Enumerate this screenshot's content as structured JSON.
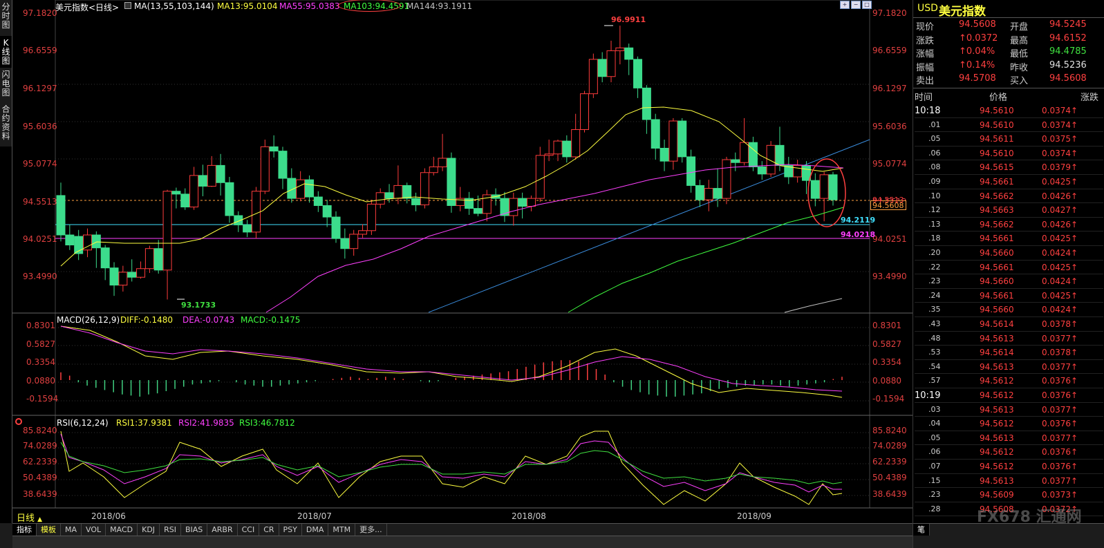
{
  "left_tabs": [
    {
      "label": "分时图"
    },
    {
      "label": "K线图"
    },
    {
      "label": "闪电图"
    },
    {
      "label": "合约资料"
    }
  ],
  "header": {
    "title": "美元指数<日线>",
    "ma_params": "MA(13,55,103,144)",
    "ma13": "MA13:95.0104",
    "ma55": "MA55:95.0383",
    "ma103": "MA103:94.4591",
    "ma144": "MA144:93.1911"
  },
  "price_axis": [
    "97.1820",
    "96.6559",
    "96.1297",
    "95.6036",
    "95.0774",
    "94.5513",
    "94.0251",
    "93.4990"
  ],
  "annotations": {
    "high_label": "96.9911",
    "low_label": "93.1733",
    "current_price_box": "94.5608",
    "cyan_label": "94.2119",
    "magenta_label": "94.0218",
    "small_label": "94.5513"
  },
  "macd": {
    "title": "MACD(26,12,9)",
    "diff": "DIFF:-0.1480",
    "dea": "DEA:-0.0743",
    "macd": "MACD:-0.1475",
    "axis": [
      "0.8301",
      "0.5827",
      "0.3354",
      "0.0880",
      "-0.1594"
    ]
  },
  "rsi": {
    "title": "RSI(6,12,24)",
    "rsi1": "RSI1:37.9381",
    "rsi2": "RSI2:41.9835",
    "rsi3": "RSI3:46.7812",
    "axis": [
      "85.8240",
      "74.0289",
      "62.2339",
      "50.4389",
      "38.6439"
    ]
  },
  "dates": [
    "2018/06",
    "2018/07",
    "2018/08",
    "2018/09"
  ],
  "period_button": "日线",
  "bottom_tabs": [
    "指标",
    "模板",
    "MA",
    "VOL",
    "MACD",
    "KDJ",
    "RSI",
    "BIAS",
    "ARBR",
    "CCI",
    "CR",
    "PSY",
    "DMA",
    "MTM",
    "更多..."
  ],
  "quote": {
    "symbol": "USD",
    "name": "美元指数",
    "rows": [
      {
        "l1": "现价",
        "v1": "94.5608",
        "c1": "#ff4040",
        "l2": "开盘",
        "v2": "94.5245",
        "c2": "#ff4040"
      },
      {
        "l1": "涨跌",
        "v1": "↑0.0372",
        "c1": "#ff4040",
        "l2": "最高",
        "v2": "94.6152",
        "c2": "#ff4040"
      },
      {
        "l1": "涨幅",
        "v1": "↑0.04%",
        "c1": "#ff4040",
        "l2": "最低",
        "v2": "94.4785",
        "c2": "#40e040"
      },
      {
        "l1": "振幅",
        "v1": "↑0.14%",
        "c1": "#ff4040",
        "l2": "昨收",
        "v2": "94.5236",
        "c2": "#e0e0e0"
      },
      {
        "l1": "卖出",
        "v1": "94.5708",
        "c1": "#ff4040",
        "l2": "买入",
        "v2": "94.5608",
        "c2": "#ff4040"
      }
    ]
  },
  "ts_header": {
    "time": "时间",
    "price": "价格",
    "change": "涨跌"
  },
  "ticks": [
    {
      "t": "10:18",
      "p": "94.5610",
      "c": "0.0374↑"
    },
    {
      "t": ".01",
      "p": "94.5610",
      "c": "0.0374↑"
    },
    {
      "t": ".05",
      "p": "94.5611",
      "c": "0.0375↑"
    },
    {
      "t": ".06",
      "p": "94.5610",
      "c": "0.0374↑"
    },
    {
      "t": ".08",
      "p": "94.5615",
      "c": "0.0379↑"
    },
    {
      "t": ".09",
      "p": "94.5661",
      "c": "0.0425↑"
    },
    {
      "t": ".10",
      "p": "94.5662",
      "c": "0.0426↑"
    },
    {
      "t": ".12",
      "p": "94.5663",
      "c": "0.0427↑"
    },
    {
      "t": ".13",
      "p": "94.5662",
      "c": "0.0426↑"
    },
    {
      "t": ".18",
      "p": "94.5661",
      "c": "0.0425↑"
    },
    {
      "t": ".20",
      "p": "94.5660",
      "c": "0.0424↑"
    },
    {
      "t": ".22",
      "p": "94.5661",
      "c": "0.0425↑"
    },
    {
      "t": ".23",
      "p": "94.5660",
      "c": "0.0424↑"
    },
    {
      "t": ".24",
      "p": "94.5661",
      "c": "0.0425↑"
    },
    {
      "t": ".35",
      "p": "94.5660",
      "c": "0.0424↑"
    },
    {
      "t": ".43",
      "p": "94.5614",
      "c": "0.0378↑"
    },
    {
      "t": ".48",
      "p": "94.5613",
      "c": "0.0377↑"
    },
    {
      "t": ".53",
      "p": "94.5614",
      "c": "0.0378↑"
    },
    {
      "t": ".54",
      "p": "94.5613",
      "c": "0.0377↑"
    },
    {
      "t": ".57",
      "p": "94.5612",
      "c": "0.0376↑"
    },
    {
      "t": "10:19",
      "p": "94.5612",
      "c": "0.0376↑"
    },
    {
      "t": ".03",
      "p": "94.5613",
      "c": "0.0377↑"
    },
    {
      "t": ".04",
      "p": "94.5612",
      "c": "0.0376↑"
    },
    {
      "t": ".05",
      "p": "94.5613",
      "c": "0.0377↑"
    },
    {
      "t": ".06",
      "p": "94.5612",
      "c": "0.0376↑"
    },
    {
      "t": ".07",
      "p": "94.5612",
      "c": "0.0376↑"
    },
    {
      "t": ".15",
      "p": "94.5613",
      "c": "0.0377↑"
    },
    {
      "t": ".23",
      "p": "94.5609",
      "c": "0.0373↑"
    },
    {
      "t": ".28",
      "p": "94.5608",
      "c": "0.0372↑"
    }
  ],
  "watermark": "FX678 汇通网",
  "right_bottom_button": "笔",
  "colors": {
    "up": "#ff3c3c",
    "down": "#3cdc8c",
    "ma13": "#ffff40",
    "ma55": "#ff40ff",
    "ma103": "#40ff40",
    "ma144": "#c0c0c0",
    "axis": "#ff4040"
  }
}
